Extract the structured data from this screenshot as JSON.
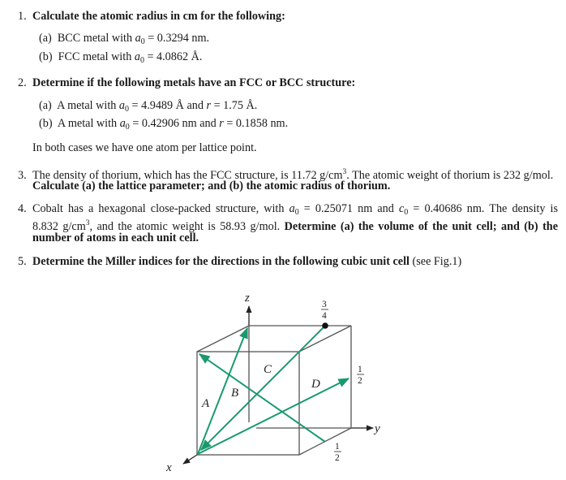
{
  "problems": [
    {
      "number": "1.",
      "heading": "Calculate the atomic radius in cm for the following:",
      "parts": [
        {
          "label": "(a)",
          "text_before": "BCC metal with ",
          "var": "a",
          "sub": "0",
          "text_after": " = 0.3294 nm."
        },
        {
          "label": "(b)",
          "text_before": "FCC metal with ",
          "var": "a",
          "sub": "0",
          "text_after": " = 4.0862 Å."
        }
      ]
    },
    {
      "number": "2.",
      "heading": "Determine if the following metals have an FCC or BCC structure:",
      "parts": [
        {
          "label": "(a)",
          "text_before": "A metal with ",
          "var": "a",
          "sub": "0",
          "mid": " = 4.9489 Å and ",
          "var2": "r",
          "text_after": " = 1.75 Å."
        },
        {
          "label": "(b)",
          "text_before": "A metal with ",
          "var": "a",
          "sub": "0",
          "mid": " = 0.42906 nm and ",
          "var2": "r",
          "text_after": " = 0.1858 nm."
        }
      ],
      "note": "In both cases we have one atom per lattice point."
    },
    {
      "number": "3.",
      "line1_pre": "The density of thorium, which has the FCC structure, is 11.72 g/cm",
      "line1_sup": "3",
      "line1_post": ". The atomic weight of thorium is 232 g/mol.",
      "line2_bold": "Calculate (a) the lattice parameter; and (b) the atomic radius of thorium."
    },
    {
      "number": "4.",
      "line1_pre": "Cobalt has a hexagonal close-packed structure, with ",
      "a_var": "a",
      "a_sub": "0",
      "a_val": " = 0.25071 nm and ",
      "c_var": "c",
      "c_sub": "0",
      "c_val": " = 0.40686 nm.  The density is",
      "line2_pre": "8.832 g/cm",
      "line2_sup": "3",
      "line2_post": ", and the atomic weight is 58.93 g/mol. ",
      "line2_bold": "Determine (a) the volume of the unit cell; and (b) the",
      "line3_bold": "number of atoms in each unit cell."
    },
    {
      "number": "5.",
      "heading": "Determine the Miller indices for the directions in the following cubic unit cell",
      "ref": " (see Fig.1)"
    }
  ],
  "figure": {
    "name": "Fig.1",
    "axes": {
      "x": "x",
      "y": "y",
      "z": "z"
    },
    "direction_labels": [
      "A",
      "B",
      "C",
      "D"
    ],
    "fractions": {
      "top_edge": {
        "num": "3",
        "den": "4"
      },
      "right_edge": {
        "num": "1",
        "den": "2"
      },
      "bottom_edge": {
        "num": "1",
        "den": "2"
      }
    },
    "colors": {
      "arrow": "#1a9a6c",
      "cube": "#555555",
      "axis": "#222222"
    }
  }
}
